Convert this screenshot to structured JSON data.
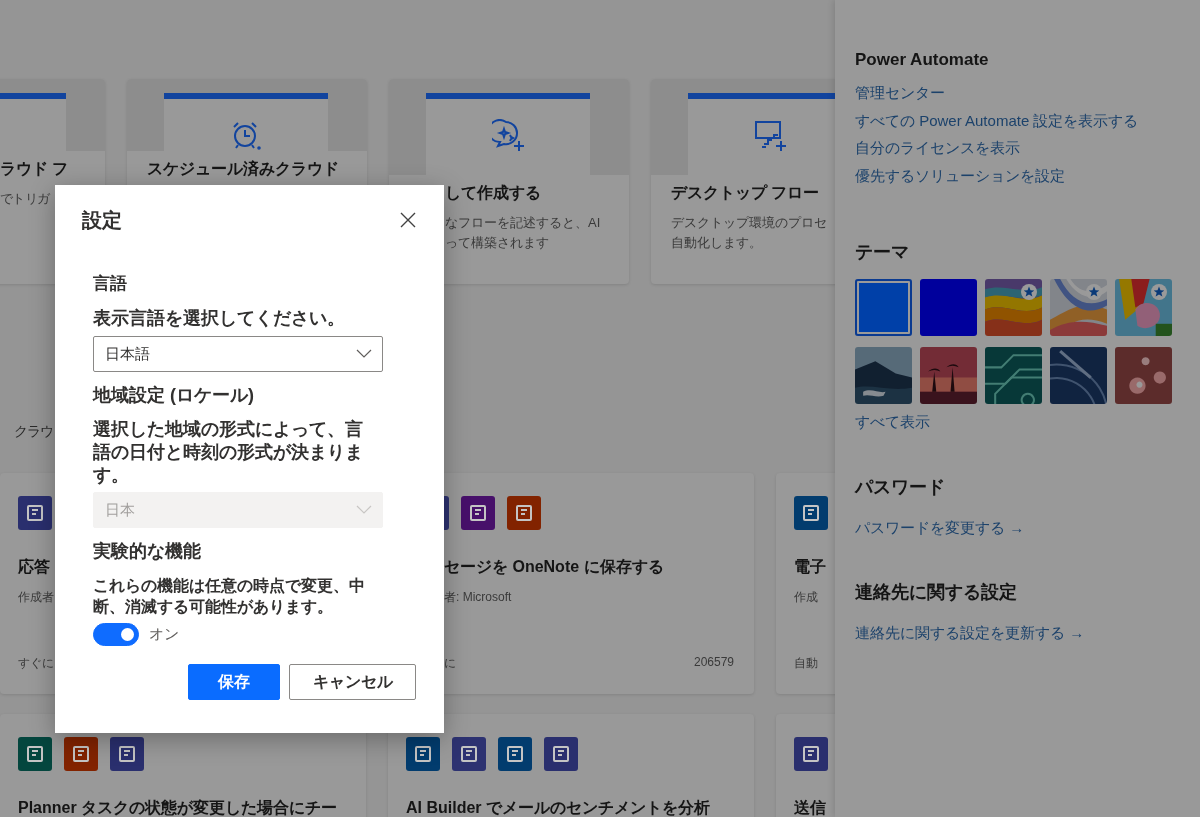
{
  "template_cards": [
    {
      "title": "ラウド フ",
      "description": [
        "でトリガ"
      ]
    },
    {
      "title": "スケジュール済みクラウド"
    },
    {
      "title": "して作成する",
      "description": [
        "なフローを記述すると、AI",
        "って構築されます"
      ]
    },
    {
      "title": "デスクトップ フロー",
      "description": [
        "デスクトップ環境のプロセ",
        "自動化します。"
      ]
    }
  ],
  "section_label": "クラウ",
  "flow_cards": [
    {
      "icons": [
        {
          "color": "#2a2f6e"
        }
      ],
      "title": "応答",
      "author": "作成者",
      "footer": "すぐに"
    },
    {
      "icons": [
        {
          "color": "#2d3271"
        },
        {
          "color": "#47106a"
        },
        {
          "color": "#822300"
        }
      ],
      "title": "セージを OneNote に保存する",
      "author": "者: Microsoft",
      "footer": "に",
      "count": "206579"
    },
    {
      "icons": [
        {
          "color": "#023c6e"
        }
      ],
      "title": "電子",
      "author": "作成",
      "footer": "自動"
    },
    {
      "icons": [
        {
          "color": "#04463e"
        },
        {
          "color": "#822300"
        },
        {
          "color": "#2a2f6e"
        }
      ],
      "title": "Planner タスクの状態が変更した場合にチー"
    },
    {
      "icons": [
        {
          "color": "#023c6e"
        },
        {
          "color": "#2d3271"
        },
        {
          "color": "#023c6e"
        },
        {
          "color": "#2a2f6e"
        }
      ],
      "title": "AI Builder でメールのセンチメントを分析"
    },
    {
      "icons": [
        {
          "color": "#2a2f6e"
        }
      ],
      "title": "送信"
    }
  ],
  "settings_panel": {
    "product_heading": "Power Automate",
    "links": [
      "管理センター",
      "すべての Power Automate 設定を表示する",
      "自分のライセンスを表示",
      "優先するソリューションを設定"
    ],
    "theme_heading": "テーマ",
    "themes": [
      {
        "kind": "color",
        "color": "#0040a8",
        "selected": true,
        "featured": false
      },
      {
        "kind": "color",
        "color": "#00009c",
        "selected": false,
        "featured": false
      },
      {
        "kind": "picture",
        "selected": false,
        "featured": true
      },
      {
        "kind": "picture",
        "selected": false,
        "featured": true
      },
      {
        "kind": "picture",
        "selected": false,
        "featured": true
      },
      {
        "kind": "picture",
        "selected": false,
        "featured": false
      },
      {
        "kind": "picture",
        "selected": false,
        "featured": false
      },
      {
        "kind": "picture",
        "selected": false,
        "featured": false
      },
      {
        "kind": "picture",
        "selected": false,
        "featured": false
      },
      {
        "kind": "picture",
        "selected": false,
        "featured": false
      }
    ],
    "show_all": "すべて表示",
    "password_heading": "パスワード",
    "password_link": "パスワードを変更する →",
    "contact_heading": "連絡先に関する設定",
    "contact_link": "連絡先に関する設定を更新する →"
  },
  "dialog": {
    "title": "設定",
    "language_heading": "言語",
    "language_prompt": "表示言語を選択してください。",
    "language": {
      "value": "日本語",
      "disabled": false
    },
    "locale_heading": "地域設定 (ロケール)",
    "locale_note": "選択した地域の形式によって、言語の日付と時刻の形式が決まります。",
    "locale": {
      "value": "日本",
      "disabled": true
    },
    "experimental_heading": "実験的な機能",
    "experimental_note": "これらの機能は任意の時点で変更、中断、消滅する可能性があります。",
    "experimental_toggle": {
      "on": true,
      "label": "オン"
    },
    "buttons": [
      {
        "label": "保存",
        "primary": true
      },
      {
        "label": "キャンセル",
        "primary": false
      }
    ]
  }
}
